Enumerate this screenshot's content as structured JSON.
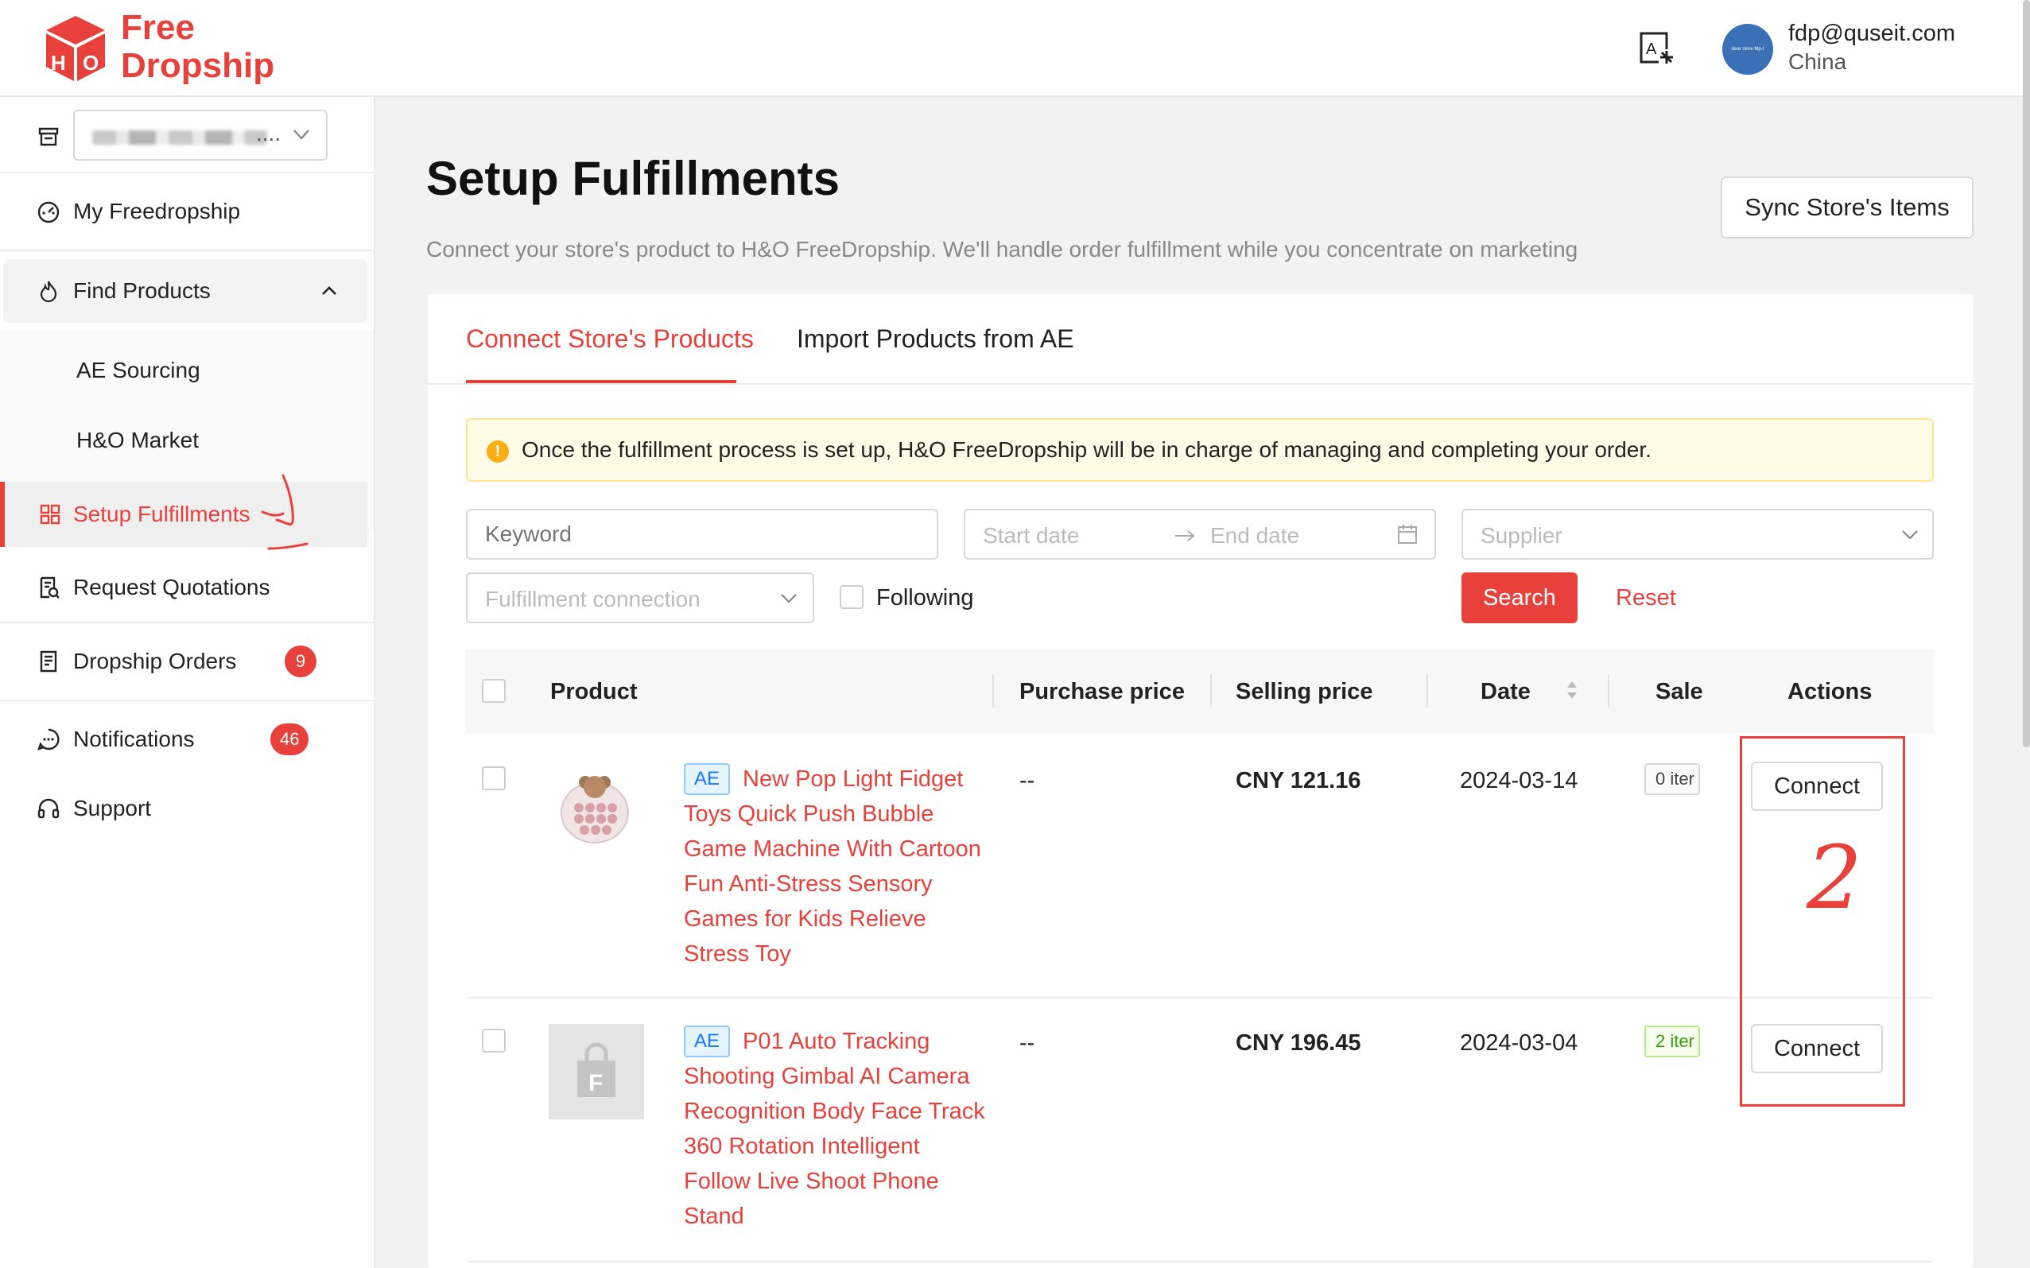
{
  "header": {
    "logo_line1": "Free",
    "logo_line2": "Dropship",
    "logo_icon": "box-icon",
    "avatar_text": "dear store fdp-t",
    "user_email": "fdp@quseit.com",
    "user_country": "China",
    "translate_icon": "translate-icon"
  },
  "sidebar": {
    "store_select": {
      "value": "...."
    },
    "items": [
      {
        "label": "My Freedropship",
        "icon": "dashboard-icon"
      },
      {
        "label": "Find Products",
        "icon": "flame-icon"
      },
      {
        "label": "AE Sourcing"
      },
      {
        "label": "H&O Market"
      },
      {
        "label": "Setup Fulfillments",
        "icon": "grid-icon"
      },
      {
        "label": "Request Quotations",
        "icon": "quotation-icon"
      },
      {
        "label": "Dropship Orders",
        "icon": "orders-icon",
        "badge": "9"
      },
      {
        "label": "Notifications",
        "icon": "chat-icon",
        "badge": "46"
      },
      {
        "label": "Support",
        "icon": "headset-icon"
      }
    ]
  },
  "main": {
    "title": "Setup Fulfillments",
    "subtitle": "Connect your store's product to H&O FreeDropship. We'll handle order fulfillment while you concentrate on marketing",
    "sync_button": "Sync Store's Items",
    "tabs": [
      {
        "label": "Connect Store's Products",
        "active": true
      },
      {
        "label": "Import Products from AE",
        "active": false
      }
    ],
    "alert": "Once the fulfillment process is set up, H&O FreeDropship will be in charge of managing and completing your order.",
    "filters": {
      "keyword_placeholder": "Keyword",
      "start_date_placeholder": "Start date",
      "end_date_placeholder": "End date",
      "supplier_placeholder": "Supplier",
      "fulfillment_placeholder": "Fulfillment connection",
      "following_label": "Following",
      "search_button": "Search",
      "reset_button": "Reset"
    },
    "table": {
      "columns": [
        "Product",
        "Purchase price",
        "Selling price",
        "Date",
        "Sale:",
        "Actions"
      ],
      "rows": [
        {
          "tag": "AE",
          "name_lines": [
            "New Pop Light Fidget",
            "Toys Quick Push Bubble",
            "Game Machine With Cartoon",
            "Fun Anti-Stress Sensory",
            "Games for Kids Relieve",
            "Stress Toy"
          ],
          "purchase_price": "--",
          "selling_price": "CNY 121.16",
          "date": "2024-03-14",
          "sales": "0 iter",
          "action": "Connect"
        },
        {
          "tag": "AE",
          "name_lines": [
            "P01 Auto Tracking",
            "Shooting Gimbal AI Camera",
            "Recognition Body Face Track",
            "360 Rotation Intelligent",
            "Follow Live Shoot Phone",
            "Stand"
          ],
          "purchase_price": "--",
          "selling_price": "CNY 196.45",
          "date": "2024-03-04",
          "sales": "2 iter",
          "action": "Connect"
        }
      ]
    }
  },
  "annotations": {
    "step2_label": "2",
    "color": "#e8403b"
  }
}
